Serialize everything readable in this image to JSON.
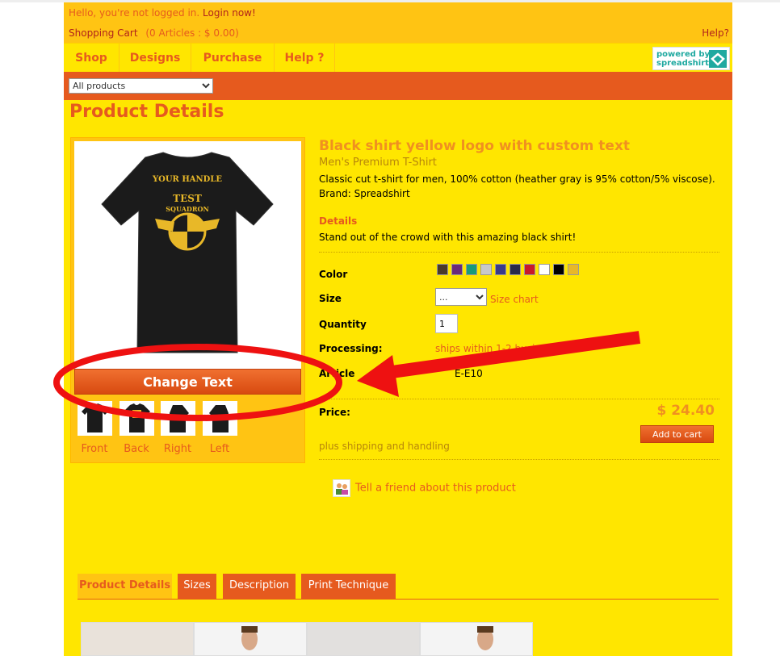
{
  "topbar": {
    "greeting": "Hello, you're not logged in.",
    "login_link": "Login now!",
    "cart_label": "Shopping Cart",
    "cart_count": "(0 Articles : $ 0.00)",
    "help_label": "Help?"
  },
  "nav": {
    "items": [
      {
        "label": "Shop"
      },
      {
        "label": "Designs"
      },
      {
        "label": "Purchase"
      },
      {
        "label": "Help ?"
      }
    ],
    "powered_by_line1": "powered by",
    "powered_by_line2": "spreadshirt"
  },
  "filter": {
    "selected": "All products"
  },
  "page": {
    "title": "Product Details"
  },
  "product_image": {
    "shirt_text_top": "YOUR HANDLE",
    "shirt_text_logo1": "TEST",
    "shirt_text_logo2": "SQUADRON",
    "change_text_button": "Change Text",
    "views": [
      {
        "label": "Front"
      },
      {
        "label": "Back"
      },
      {
        "label": "Right"
      },
      {
        "label": "Left"
      }
    ]
  },
  "product": {
    "title": "Black shirt yellow logo with custom text",
    "type": "Men's Premium T-Shirt",
    "description": "Classic cut t-shirt for men, 100% cotton (heather gray is 95% cotton/5% viscose).",
    "brand": "Brand: Spreadshirt",
    "details_label": "Details",
    "details_text": "Stand out of the crowd with this amazing black shirt!",
    "color_label": "Color",
    "colors": [
      "#4a3b2a",
      "#6a2a7a",
      "#1a9a7a",
      "#c8c8c8",
      "#3a3a8a",
      "#2a2a4a",
      "#c81a2a",
      "#ffffff",
      "#000000",
      "#e8b828"
    ],
    "size_label": "Size",
    "size_value": "...",
    "size_chart": "Size chart",
    "quantity_label": "Quantity",
    "quantity_value": "1",
    "processing_label": "Processing:",
    "processing_value": "ships within 1-2 busines",
    "article_label": "Article",
    "article_value": "E-E10",
    "price_label": "Price:",
    "price_value": "$ 24.40",
    "add_to_cart": "Add to cart",
    "shipping": "plus shipping and handling",
    "tell_friend": "Tell a friend about this product"
  },
  "tabs": [
    {
      "label": "Product Details"
    },
    {
      "label": "Sizes"
    },
    {
      "label": "Description"
    },
    {
      "label": "Print Technique"
    }
  ],
  "annotation": {
    "color": "#ee1111"
  }
}
